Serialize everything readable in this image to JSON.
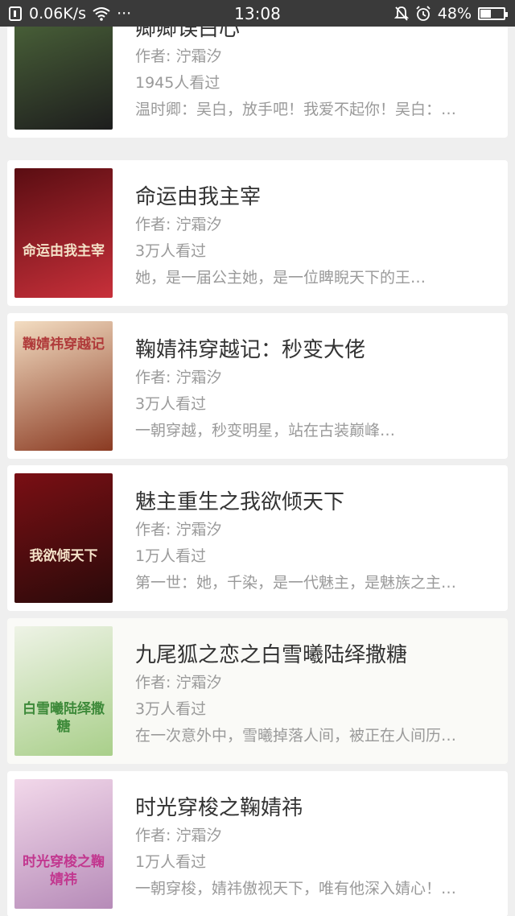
{
  "status_bar": {
    "speed": "0.06K/s",
    "more": "···",
    "time": "13:08",
    "battery": "48%",
    "battery_level": 0.48,
    "icons": [
      "sim-icon",
      "wifi-icon",
      "mute-icon",
      "alarm-icon",
      "battery-icon"
    ]
  },
  "books": [
    {
      "title": "卿卿误白心",
      "author": "作者: 泞霜汐",
      "views": "1945人看过",
      "desc": "温时卿：吴白，放手吧！我爱不起你！吴白：…",
      "cover_colors": [
        "#4f6a3c",
        "#1d1d1d"
      ],
      "cover_text": ""
    },
    {
      "title": "命运由我主宰",
      "author": "作者: 泞霜汐",
      "views": "3万人看过",
      "desc": "她，是一届公主她，是一位睥睨天下的王…",
      "cover_colors": [
        "#5a0d12",
        "#c8303a"
      ],
      "cover_text": "命运由我主宰"
    },
    {
      "title": "鞠婧祎穿越记：秒变大佬",
      "author": "作者: 泞霜汐",
      "views": "3万人看过",
      "desc": "一朝穿越，秒变明星，站在古装巅峰…",
      "cover_colors": [
        "#f3ddc2",
        "#8a3a22"
      ],
      "cover_text": "鞠婧祎穿越记"
    },
    {
      "title": "魅主重生之我欲倾天下",
      "author": "作者: 泞霜汐",
      "views": "1万人看过",
      "desc": "第一世：她，千染，是一代魅主，是魅族之主…",
      "cover_colors": [
        "#7a0f14",
        "#2a0a0a"
      ],
      "cover_text": "我欲倾天下"
    },
    {
      "title": "九尾狐之恋之白雪曦陆绎撒糖",
      "author": "作者: 泞霜汐",
      "views": "3万人看过",
      "desc": "在一次意外中，雪曦掉落人间，被正在人间历…",
      "cover_colors": [
        "#eef3e6",
        "#a9cf8a"
      ],
      "cover_text": "白雪曦陆绎撒糖"
    },
    {
      "title": "时光穿梭之鞠婧祎",
      "author": "作者: 泞霜汐",
      "views": "1万人看过",
      "desc": "一朝穿梭，婧祎傲视天下，唯有他深入婧心！…",
      "cover_colors": [
        "#f2d8ea",
        "#b68bb8"
      ],
      "cover_text": "时光穿梭之鞠婧祎"
    }
  ]
}
